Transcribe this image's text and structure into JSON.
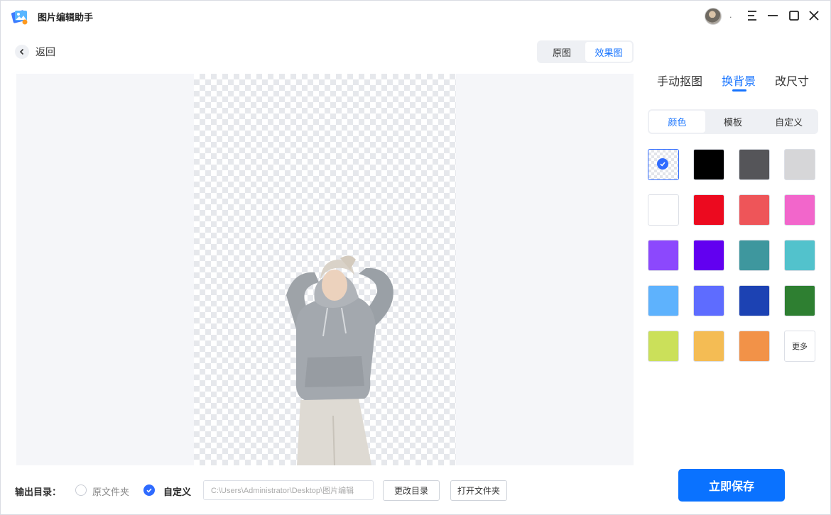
{
  "app": {
    "title": "图片编辑助手",
    "user": "."
  },
  "nav": {
    "back_label": "返回"
  },
  "view_toggle": {
    "original": "原图",
    "effect": "效果图",
    "active": "effect"
  },
  "panel": {
    "tabs": [
      "手动抠图",
      "换背景",
      "改尺寸"
    ],
    "active_tab": "换背景",
    "sub_tabs": [
      "颜色",
      "模板",
      "自定义"
    ],
    "active_sub_tab": "颜色",
    "swatches": [
      {
        "type": "transparent",
        "selected": true
      },
      {
        "color": "#000000"
      },
      {
        "color": "#555559"
      },
      {
        "color": "#d6d6d8"
      },
      {
        "color": "#ffffff"
      },
      {
        "color": "#ec0a1f"
      },
      {
        "color": "#ee5559"
      },
      {
        "color": "#f266cb"
      },
      {
        "color": "#8c48fd"
      },
      {
        "color": "#6200f0"
      },
      {
        "color": "#3e979e"
      },
      {
        "color": "#52c2cc"
      },
      {
        "color": "#5eb2fd"
      },
      {
        "color": "#5e6cff"
      },
      {
        "color": "#1c42b3"
      },
      {
        "color": "#2e7f31"
      },
      {
        "color": "#cbe05a"
      },
      {
        "color": "#f4bc54"
      },
      {
        "color": "#f29248"
      },
      {
        "type": "more",
        "label": "更多"
      }
    ]
  },
  "output": {
    "label": "输出目录：",
    "option_original": "原文件夹",
    "option_custom": "自定义",
    "selected": "custom",
    "path": "C:\\Users\\Administrator\\Desktop\\图片编辑",
    "change_dir": "更改目录",
    "open_folder": "打开文件夹"
  },
  "save_label": "立即保存",
  "colors": {
    "accent": "#1673ff",
    "primary_button": "#0a72ff"
  }
}
